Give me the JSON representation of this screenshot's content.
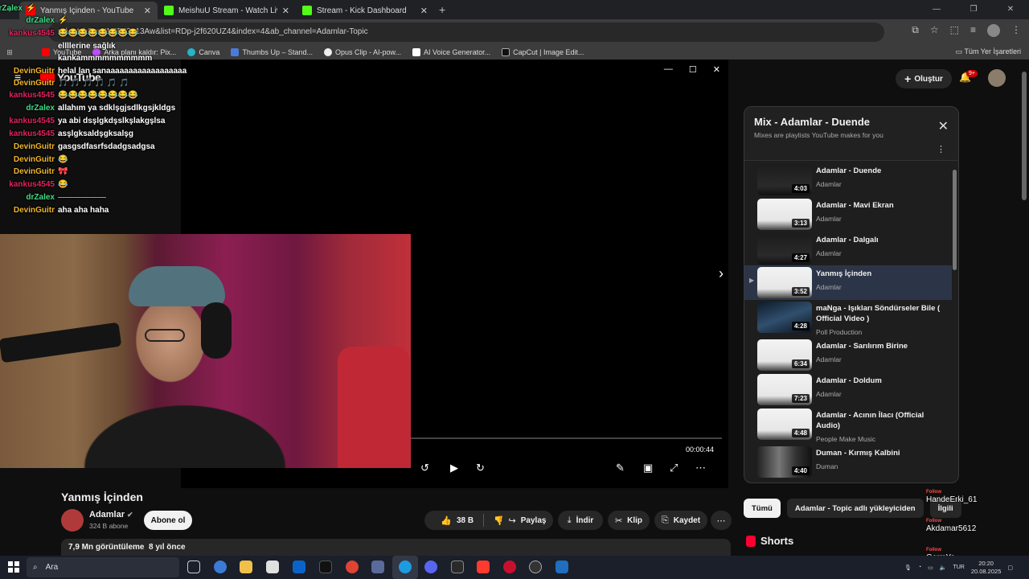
{
  "browser": {
    "tabs": [
      {
        "title": "Yanmış İçinden - YouTube",
        "icon": "youtube-favicon",
        "active": true
      },
      {
        "title": "MeishuU Stream - Watch Live o",
        "icon": "kick-favicon",
        "active": false
      },
      {
        "title": "Stream - Kick Dashboard",
        "icon": "kick-favicon",
        "active": false
      }
    ],
    "url": "m/watch?v=NN6EJ3o13Aw&list=RDp-j2f620UZ4&index=4&ab_channel=Adamlar-Topic",
    "bookmarks": [
      "YouTube",
      "Arka planı kaldır: Pix...",
      "Canva",
      "Thumbs Up – Stand...",
      "Opus Clip - AI-pow...",
      "AI Voice Generator...",
      "CapCut | Image Edit..."
    ],
    "bookmarks_all": "Tüm Yer İşaretleri"
  },
  "youtube": {
    "logo": "YouTube",
    "create_label": "Oluştur",
    "notifications_badge": "9+",
    "player": {
      "current_time": "00:00:44"
    },
    "video": {
      "title": "Yanmış İçinden",
      "channel": "Adamlar",
      "subscribers": "324 B abone",
      "subscribe_label": "Abone ol",
      "likes": "38 B",
      "share": "Paylaş",
      "download": "İndir",
      "clip": "Klip",
      "save": "Kaydet",
      "views": "7,9 Mn görüntüleme",
      "age": "8 yıl önce"
    },
    "playlist": {
      "title": "Mix - Adamlar - Duende",
      "subtitle": "Mixes are playlists YouTube makes for you",
      "items": [
        {
          "title": "Adamlar - Duende",
          "channel": "Adamlar",
          "duration": "4:03"
        },
        {
          "title": "Adamlar - Mavi Ekran",
          "channel": "Adamlar",
          "duration": "3:13"
        },
        {
          "title": "Adamlar - Dalgalı",
          "channel": "Adamlar",
          "duration": "4:27"
        },
        {
          "title": "Yanmış İçinden",
          "channel": "Adamlar",
          "duration": "3:52"
        },
        {
          "title": "maNga - Işıkları Söndürseler Bile ( Official Video )",
          "channel": "Poll Production",
          "duration": "4:28"
        },
        {
          "title": "Adamlar - Sarılırım Birine",
          "channel": "Adamlar",
          "duration": "6:34"
        },
        {
          "title": "Adamlar - Doldum",
          "channel": "Adamlar",
          "duration": "7:23"
        },
        {
          "title": "Adamlar - Acının İlacı (Official Audio)",
          "channel": "People Make Music",
          "duration": "4:48"
        },
        {
          "title": "Duman - Kırmış Kalbini",
          "channel": "Duman",
          "duration": "4:40"
        }
      ]
    },
    "chips": [
      "Tümü",
      "Adamlar - Topic adlı yükleyiciden",
      "İlgili"
    ],
    "shorts": "Shorts"
  },
  "chat": [
    {
      "user": "drZalex",
      "msg": "⚡",
      "color": "#3ddc84"
    },
    {
      "user": "drZalex",
      "msg": "⚡",
      "color": "#3ddc84"
    },
    {
      "user": "kankus4545",
      "msg": "😂😂😂😂😂😂😂😂",
      "color": "#e0245e"
    },
    {
      "user": "",
      "msg": "ellllerine sağlık",
      "color": "#ffffff"
    },
    {
      "user": "",
      "msg": "kankammmmmmmmmm",
      "color": "#ffffff"
    },
    {
      "user": "DevinGuitr",
      "msg": "helal lan sanaaaaaaaaaaaaaaaaaa",
      "color": "#f0b429"
    },
    {
      "user": "DevinGuitr",
      "msg": "🎵 🎵 🎵 🎵 🎵 🎵",
      "color": "#f0b429"
    },
    {
      "user": "kankus4545",
      "msg": "😂😂😂😂😂😂😂😂",
      "color": "#e0245e"
    },
    {
      "user": "drZalex",
      "msg": "allahım ya sdklşgjsdlkgsjkldgs",
      "color": "#3ddc84"
    },
    {
      "user": "kankus4545",
      "msg": "ya abi dsşlgkdşslkşlakgşlsa",
      "color": "#e0245e"
    },
    {
      "user": "kankus4545",
      "msg": "asşlgksaldşgksalşg",
      "color": "#e0245e"
    },
    {
      "user": "DevinGuitr",
      "msg": "gasgsdfasrfsdadgsadgsa",
      "color": "#f0b429"
    },
    {
      "user": "DevinGuitr",
      "msg": "😂",
      "color": "#f0b429"
    },
    {
      "user": "DevinGuitr",
      "msg": "🎀",
      "color": "#f0b429"
    },
    {
      "user": "kankus4545",
      "msg": "😂",
      "color": "#e0245e"
    },
    {
      "user": "drZalex",
      "msg": "——————",
      "color": "#3ddc84"
    },
    {
      "user": "DevinGuitr",
      "msg": "aha aha haha",
      "color": "#f0b429"
    }
  ],
  "follows": [
    {
      "tag": "Follow",
      "name": "HandeErki_61"
    },
    {
      "tag": "Follow",
      "name": "Akdamar5612"
    },
    {
      "tag": "Follow",
      "name": "GcrmYo"
    }
  ],
  "taskbar": {
    "search": "Ara",
    "lang": "TUR",
    "time": "20:20",
    "date": "20.08.2025"
  }
}
